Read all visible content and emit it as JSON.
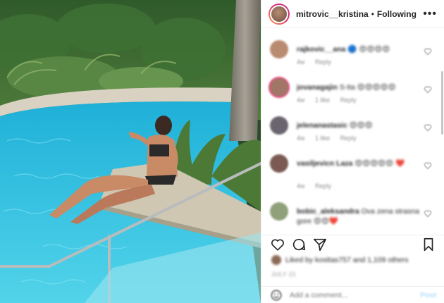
{
  "post": {
    "author": "mitrovic__kristina",
    "separator": "•",
    "follow_state": "Following",
    "more_icon": "more-options-icon"
  },
  "comments": [
    {
      "user": "rajkovic__ana",
      "text": "🔵 😍😍😍😍",
      "time": "4w",
      "likes": "",
      "reply": "Reply",
      "avatar_color": "#b98b70",
      "ring": false
    },
    {
      "user": "jovanagajin",
      "text": "S-Ita 😍😍😍😍😍",
      "time": "4w",
      "likes": "1 like",
      "reply": "Reply",
      "avatar_color": "#a07767",
      "ring": true
    },
    {
      "user": "jelenanastasic",
      "text": "😍😍😍",
      "time": "4w",
      "likes": "1 like",
      "reply": "Reply",
      "avatar_color": "#6a6570",
      "ring": false
    },
    {
      "user": "vasiljevicn Laza",
      "text": "😍😍😍😍😍 ❤️",
      "time": "4w",
      "likes": "",
      "reply": "Reply",
      "avatar_color": "#7a5a52",
      "ring": false
    },
    {
      "user": "bobic_aleksandra",
      "text": "Ova zena strasna gore 😍😍❤️",
      "time": "",
      "likes": "",
      "reply": "",
      "avatar_color": "#8fa07a",
      "ring": false
    }
  ],
  "likes_line": "Liked by kosttas757 and 1,109 others",
  "time_ago": "JULY 21",
  "composer": {
    "placeholder": "Add a comment...",
    "post_label": "Post"
  },
  "colors": {
    "accent": "#e1306c",
    "link_blue": "#0095f6",
    "muted": "#8e8e8e"
  }
}
